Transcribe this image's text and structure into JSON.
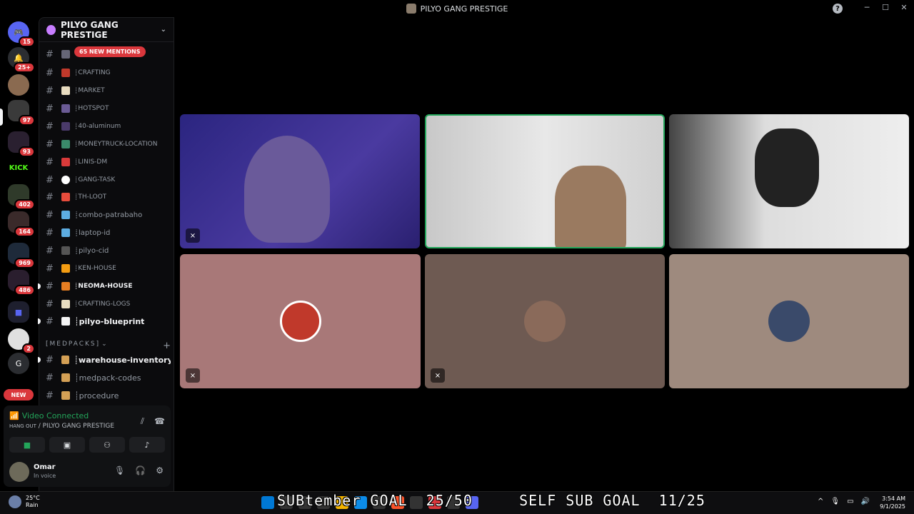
{
  "window": {
    "title": "PILYO GANG PRESTIGE"
  },
  "guilds": {
    "badges": [
      "15",
      "25+",
      "97",
      "93",
      "402",
      "164",
      "969",
      "486",
      "2"
    ],
    "kick_label": "KICK",
    "letter_server": "G",
    "new_label": "NEW"
  },
  "server": {
    "name": "PILYO GANG PRESTIGE",
    "mentions_label": "65 NEW MENTIONS",
    "channels": [
      {
        "label": ""
      },
      {
        "label": "┊crafting"
      },
      {
        "label": "┊market"
      },
      {
        "label": "┊hotspot"
      },
      {
        "label": "┊40-aluminum"
      },
      {
        "label": "┊moneytruck-location"
      },
      {
        "label": "┊linis-dm"
      },
      {
        "label": "┊gang-task"
      },
      {
        "label": "┊th-loot"
      },
      {
        "label": "┊combo-patrabaho"
      },
      {
        "label": "┊laptop-id"
      },
      {
        "label": "┊pilyo-cid"
      },
      {
        "label": "┊ken-house"
      },
      {
        "label": "┊neoma-house"
      },
      {
        "label": "┊crafting-logs"
      },
      {
        "label": "┊pilyo-blueprint"
      }
    ],
    "category": "[MEDPACKS]",
    "category_channels": [
      {
        "label": "┊warehouse-inventory"
      },
      {
        "label": "┊medpack-codes"
      },
      {
        "label": "┊procedure"
      }
    ]
  },
  "voice": {
    "status": "Video Connected",
    "location_prefix": "HANG OUT",
    "location_server": "/ PILYO GANG PRESTIGE"
  },
  "user": {
    "name": "Omar",
    "status": "In voice"
  },
  "taskbar": {
    "temp": "25°C",
    "weather": "Rain",
    "overlay_text": "SUBtember GOAL  25/50     SELF SUB GOAL  11/25",
    "time": "3:54 AM",
    "date": "9/1/2025"
  }
}
